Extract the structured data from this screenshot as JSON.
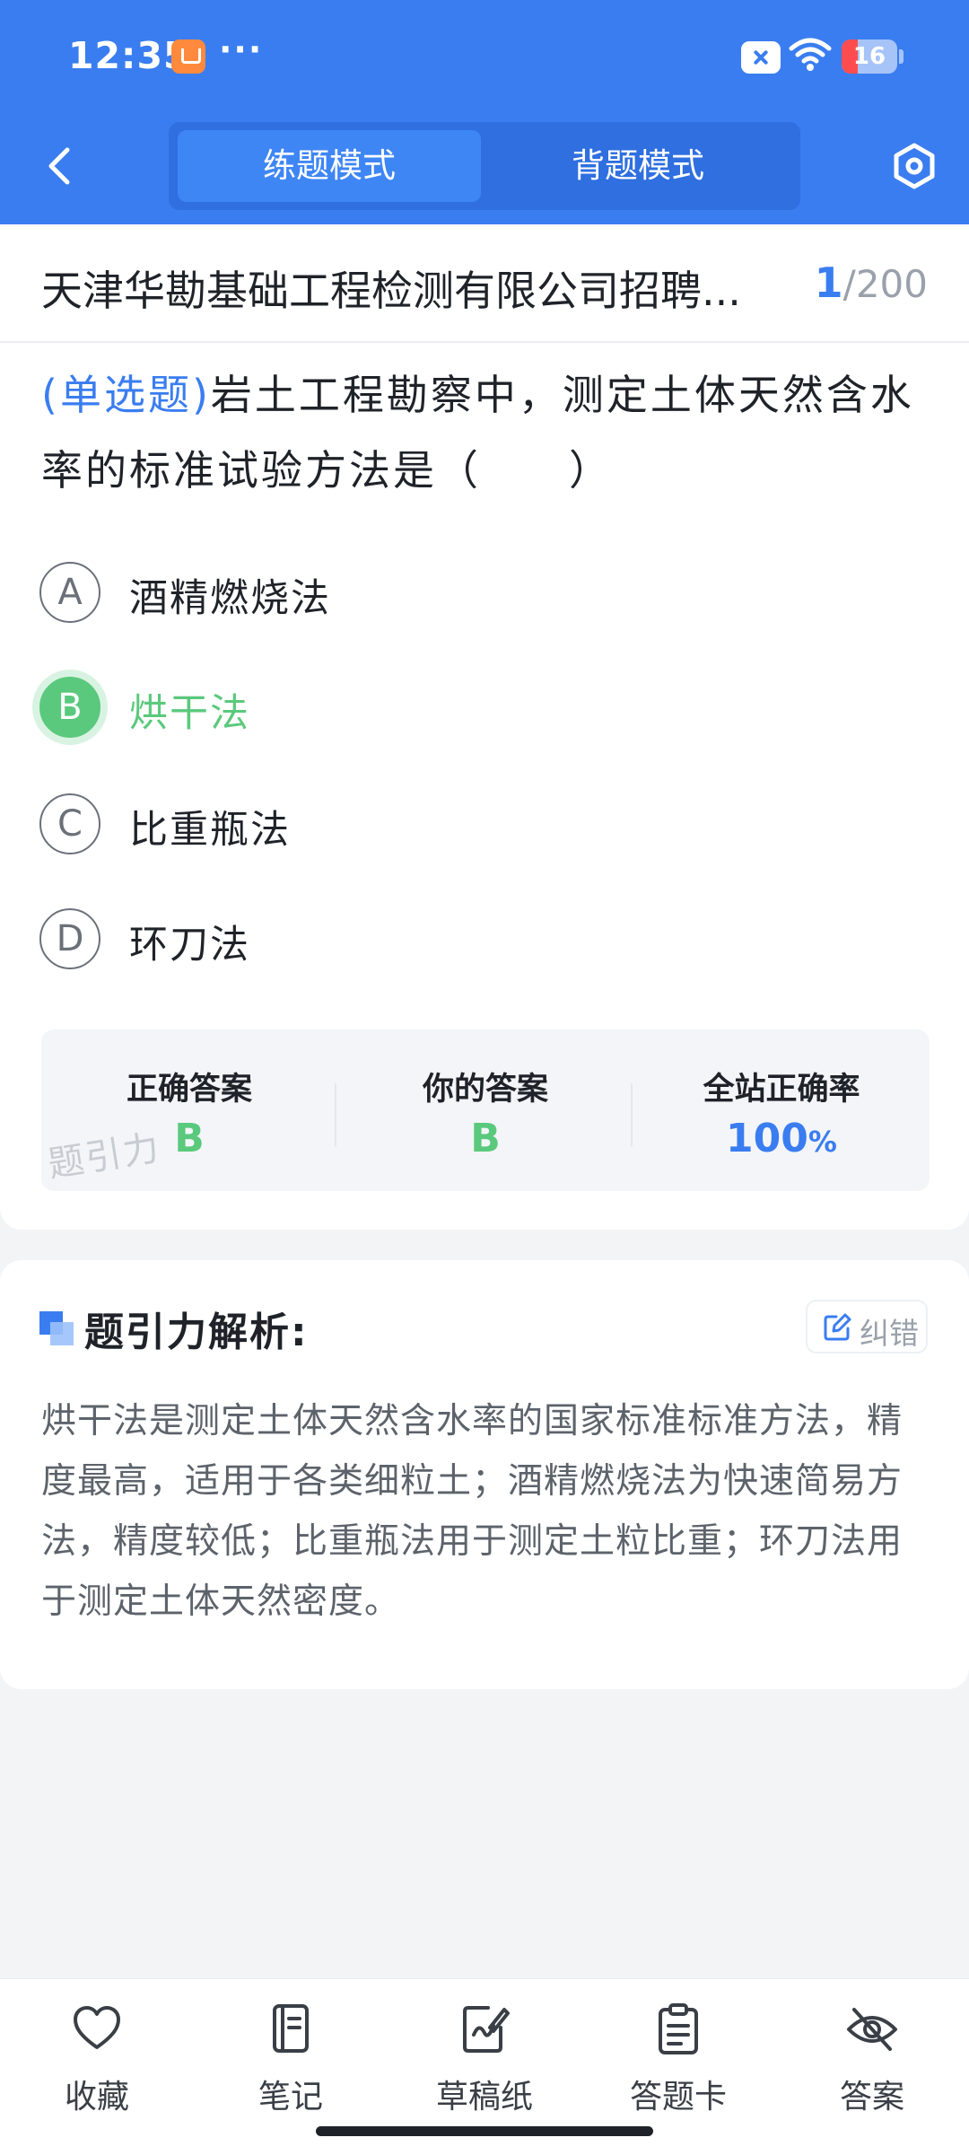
{
  "status_bar": {
    "time": "12:35",
    "dots": "···",
    "battery": "16"
  },
  "nav": {
    "modes": [
      {
        "label": "练题模式",
        "active": true
      },
      {
        "label": "背题模式",
        "active": false
      }
    ]
  },
  "exam": {
    "title": "天津华勘基础工程检测有限公司招聘...",
    "current": "1",
    "separator": "/",
    "total": "200"
  },
  "question": {
    "type": "(单选题)",
    "text": "岩土工程勘察中，测定土体天然含水率的标准试验方法是（　　）",
    "options": [
      {
        "letter": "A",
        "text": "酒精燃烧法"
      },
      {
        "letter": "B",
        "text": "烘干法",
        "state": "correct"
      },
      {
        "letter": "C",
        "text": "比重瓶法"
      },
      {
        "letter": "D",
        "text": "环刀法"
      }
    ]
  },
  "answer": {
    "correct_label": "正确答案",
    "correct_value": "B",
    "yours_label": "你的答案",
    "yours_value": "B",
    "rate_label": "全站正确率",
    "rate_value": "100",
    "rate_unit": "%",
    "watermark": "题引力"
  },
  "analysis": {
    "title": "题引力解析:",
    "report_label": "纠错",
    "text": "烘干法是测定土体天然含水率的国家标准标准方法，精度最高，适用于各类细粒土；酒精燃烧法为快速简易方法，精度较低；比重瓶法用于测定土粒比重；环刀法用于测定土体天然密度。"
  },
  "bottom_nav": [
    {
      "label": "收藏",
      "icon": "heart-icon"
    },
    {
      "label": "笔记",
      "icon": "notebook-icon"
    },
    {
      "label": "草稿纸",
      "icon": "draft-icon"
    },
    {
      "label": "答题卡",
      "icon": "clipboard-icon"
    },
    {
      "label": "答案",
      "icon": "eye-off-icon"
    }
  ],
  "colors": {
    "primary": "#3a7df0",
    "correct": "#5bc97d",
    "background": "#f3f4f6"
  }
}
